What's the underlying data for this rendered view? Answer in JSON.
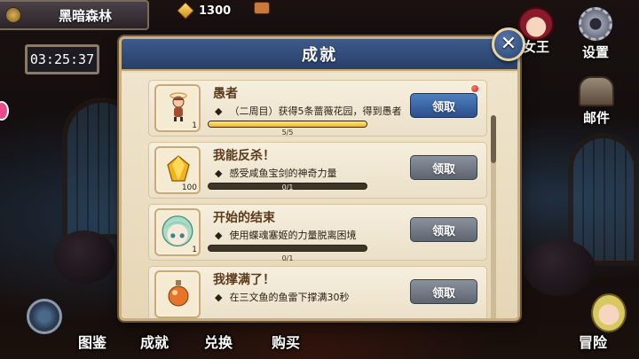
{
  "location": {
    "name": "黑暗森林",
    "pin_icon": "map-pin-icon"
  },
  "timer": "03:25:37",
  "currency": {
    "icon": "gold-gem-icon",
    "value": "1300"
  },
  "side_menu": [
    {
      "id": "queen",
      "label": "女王",
      "icon": "queen-crown-icon"
    },
    {
      "id": "settings",
      "label": "设置",
      "icon": "gear-icon"
    },
    {
      "id": "mail",
      "label": "邮件",
      "icon": "mailbox-icon"
    }
  ],
  "bottom_nav": [
    {
      "id": "codex",
      "label": "图鉴"
    },
    {
      "id": "achievements",
      "label": "成就"
    },
    {
      "id": "exchange",
      "label": "兑换"
    },
    {
      "id": "shop",
      "label": "购买"
    },
    {
      "id": "adventure",
      "label": "冒险"
    }
  ],
  "dialog": {
    "title": "成就",
    "close_icon": "close-icon",
    "achievements": [
      {
        "title": "愚者",
        "bullet": "◆",
        "description": "（二周目）获得5条蔷薇花园，得到愚者",
        "count": "1",
        "progress_text": "5/5",
        "progress": 1.0,
        "button": "领取",
        "claimable": true,
        "has_notification": true,
        "icon": "fool-character-icon"
      },
      {
        "title": "我能反杀！",
        "bullet": "◆",
        "description": "感受咸鱼宝剑的神奇力量",
        "count": "100",
        "progress_text": "0/1",
        "progress": 0.0,
        "button": "领取",
        "claimable": false,
        "has_notification": false,
        "icon": "gold-gem-icon"
      },
      {
        "title": "开始的结束",
        "bullet": "◆",
        "description": "使用蝶魂塞姬的力量脱离困境",
        "count": "1",
        "progress_text": "0/1",
        "progress": 0.0,
        "button": "领取",
        "claimable": false,
        "has_notification": false,
        "icon": "green-hair-girl-icon"
      },
      {
        "title": "我撑满了！",
        "bullet": "◆",
        "description": "在三文鱼的鱼雷下撑满30秒",
        "count": "",
        "progress_text": "",
        "progress": 0.0,
        "button": "领取",
        "claimable": false,
        "has_notification": false,
        "icon": "potion-bottle-icon"
      }
    ]
  },
  "colors": {
    "header_blue": "#2f4a78",
    "claim_active": "#3a67a8",
    "claim_disabled": "#6e7682",
    "progress_fill": "#f5c830",
    "notification_red": "#d8241a"
  }
}
